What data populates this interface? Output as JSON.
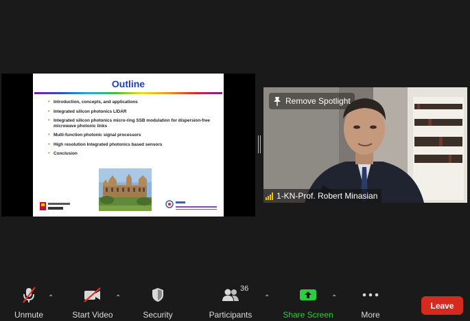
{
  "slide": {
    "title": "Outline",
    "bullets": [
      "Introduction, concepts, and applications",
      "Integrated silicon photonics LIDAR",
      "Integrated silicon photonics micro-ring SSB modulation for dispersion-free microwave photonic links",
      "Multi-function photonic signal processors",
      "High resolution Integrated photonics based sensors",
      "Conclusion"
    ],
    "logo_left_text": "SYDNEY",
    "logo_right_title": "F P L",
    "logo_right_sub": "Fibre-optics & Photonics Laboratory"
  },
  "video": {
    "spotlight_label": "Remove Spotlight",
    "participant_name": "1-KN-Prof. Robert Minasian"
  },
  "toolbar": {
    "unmute_label": "Unmute",
    "start_video_label": "Start Video",
    "security_label": "Security",
    "participants_label": "Participants",
    "participants_count": "36",
    "share_label": "Share Screen",
    "more_label": "More",
    "leave_label": "Leave"
  },
  "colors": {
    "share_green": "#2ecc40",
    "leave_red": "#d52b1e",
    "signal_yellow": "#f2c200"
  }
}
